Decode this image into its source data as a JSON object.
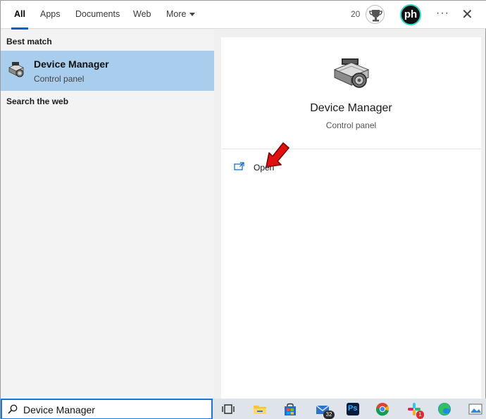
{
  "tabs": [
    {
      "label": "All",
      "active": true
    },
    {
      "label": "Apps"
    },
    {
      "label": "Documents"
    },
    {
      "label": "Web"
    },
    {
      "label": "More"
    }
  ],
  "header": {
    "points": "20",
    "avatar_text": "ph",
    "more_options": "···",
    "close": "✕"
  },
  "left_pane": {
    "best_match_label": "Best match",
    "best_match": {
      "title": "Device Manager",
      "subtitle": "Control panel",
      "icon": "device-manager-icon"
    },
    "search_web_label": "Search the web"
  },
  "right_pane": {
    "title": "Device Manager",
    "subtitle": "Control panel",
    "actions": [
      {
        "label": "Open",
        "icon": "open-icon"
      }
    ]
  },
  "search": {
    "value": "Device Manager"
  },
  "taskbar": {
    "items": [
      {
        "name": "task-view-icon"
      },
      {
        "name": "file-explorer-icon"
      },
      {
        "name": "store-icon"
      },
      {
        "name": "mail-icon",
        "badge": "32"
      },
      {
        "name": "photoshop-icon",
        "text": "Ps"
      },
      {
        "name": "chrome-icon"
      },
      {
        "name": "slack-icon",
        "badge": "1"
      },
      {
        "name": "edge-icon"
      },
      {
        "name": "photos-icon"
      }
    ]
  },
  "colors": {
    "accent": "#0a64c8",
    "selection": "#a9cdec",
    "annotation_arrow": "#e01010"
  }
}
